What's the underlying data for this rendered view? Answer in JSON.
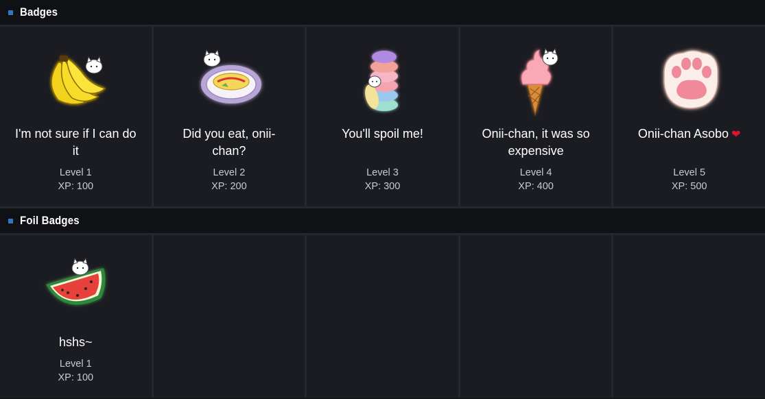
{
  "sections": {
    "badges": {
      "title": "Badges"
    },
    "foil": {
      "title": "Foil Badges"
    }
  },
  "badges": [
    {
      "icon": "banana-badge-icon",
      "title": "I'm not sure if I can do it",
      "level": "Level 1",
      "xp": "XP: 100"
    },
    {
      "icon": "omelette-badge-icon",
      "title": "Did you eat, onii-chan?",
      "level": "Level 2",
      "xp": "XP: 200"
    },
    {
      "icon": "macaron-badge-icon",
      "title": "You'll spoil me!",
      "level": "Level 3",
      "xp": "XP: 300"
    },
    {
      "icon": "ice-cream-badge-icon",
      "title": "Onii-chan, it was so expensive",
      "level": "Level 4",
      "xp": "XP: 400"
    },
    {
      "icon": "paw-badge-icon",
      "title": "Onii-chan Asobo",
      "title_suffix": "❤",
      "level": "Level 5",
      "xp": "XP: 500"
    }
  ],
  "foil_badges": [
    {
      "icon": "watermelon-badge-icon",
      "title": "hshs~",
      "level": "Level 1",
      "xp": "XP: 100"
    }
  ],
  "colors": {
    "background": "#15161a",
    "header": "#101114",
    "cell": "#1b1c21",
    "accent": "#2f78c4",
    "heart": "#e0122e"
  }
}
